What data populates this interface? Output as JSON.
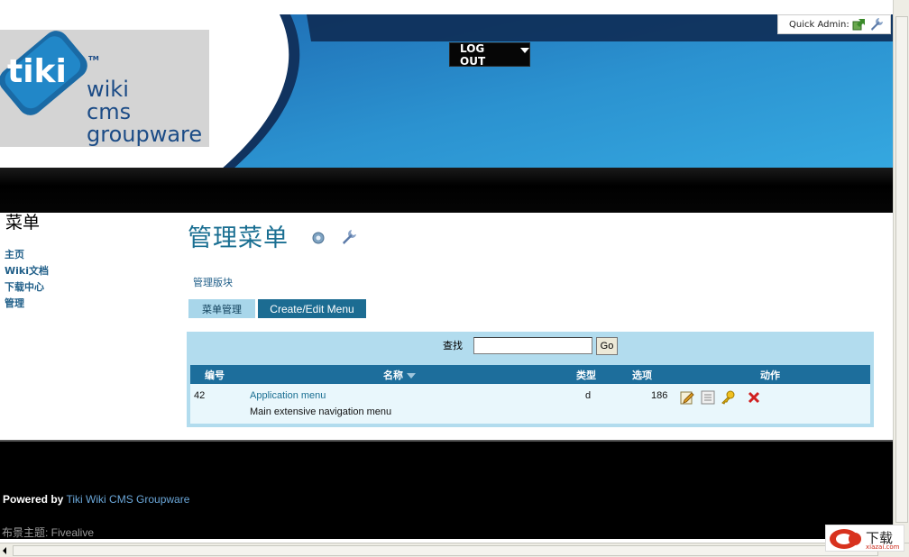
{
  "header": {
    "logo_word": "tiki",
    "logo_tm": "TM",
    "logo_lines": [
      "wiki",
      "cms",
      "groupware"
    ],
    "quick_admin_label": "Quick Admin:",
    "quick_admin_icons": [
      "module-arrow-icon",
      "wrench-icon"
    ],
    "logout_label": "LOG OUT"
  },
  "sidebar": {
    "title": "菜单",
    "items": [
      {
        "label": "主页"
      },
      {
        "label": "Wiki文档"
      },
      {
        "label": "下载中心"
      },
      {
        "label": "管理"
      }
    ]
  },
  "main": {
    "title": "管理菜单",
    "admin_link": "管理版块",
    "tabs": [
      {
        "label": "菜单管理",
        "active": true
      },
      {
        "label": "Create/Edit Menu",
        "active": false
      }
    ],
    "search": {
      "label": "查找",
      "value": "",
      "button": "Go"
    },
    "table": {
      "headers": {
        "id": "编号",
        "name": "名称",
        "type": "类型",
        "options": "选项",
        "actions": "动作"
      },
      "rows": [
        {
          "id": "42",
          "name": "Application menu",
          "description": "Main extensive navigation menu",
          "type": "d",
          "options": "186",
          "actions": [
            "edit-icon",
            "list-icon",
            "key-icon",
            "delete-icon"
          ]
        }
      ]
    }
  },
  "footer": {
    "powered_label": "Powered by",
    "powered_link": "Tiki Wiki CMS Groupware",
    "theme_line": "布景主题: Fivealive"
  },
  "watermark": {
    "text": "下载",
    "url": "xiazai.com"
  },
  "colors": {
    "banner_blue": "#2a8fcf",
    "banner_dark": "#133b6e",
    "title_teal": "#1a6f92",
    "table_head": "#1d6e9c",
    "panel_bg": "#b2dcee"
  }
}
